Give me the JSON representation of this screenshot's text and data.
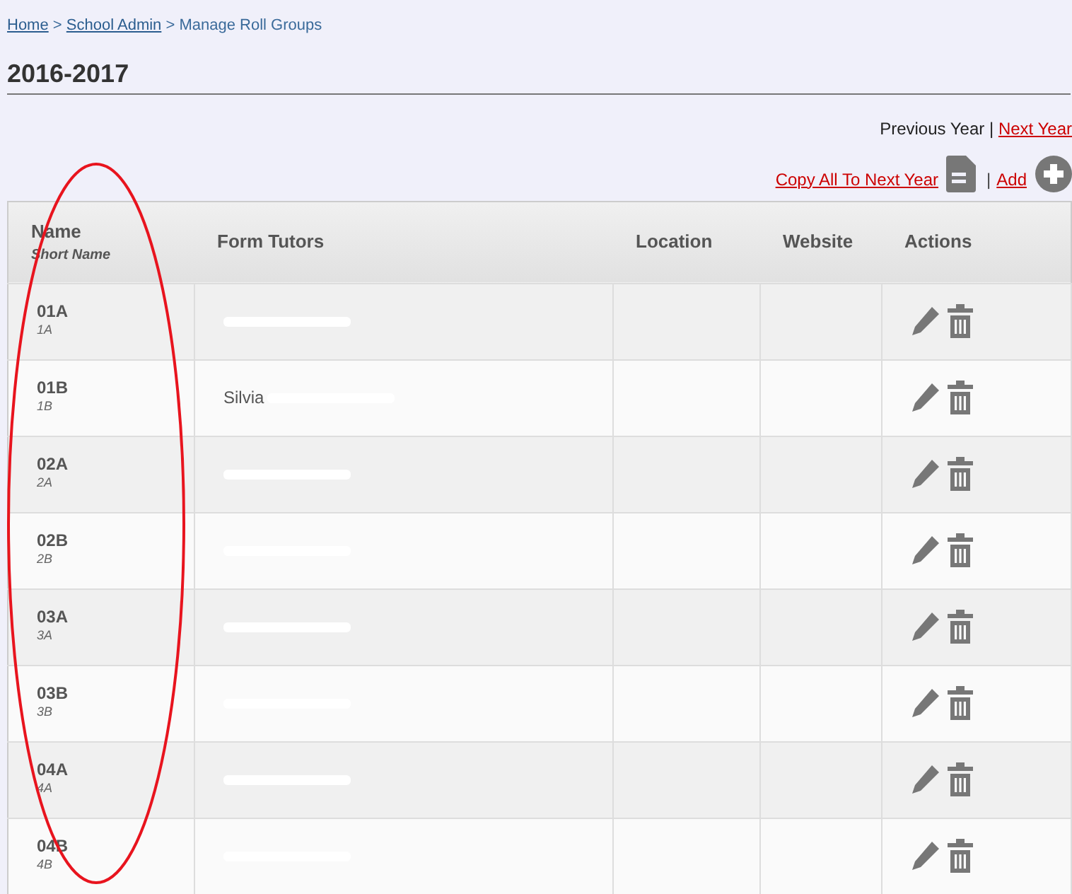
{
  "breadcrumb": [
    {
      "label": "Home",
      "link": true
    },
    {
      "label": ">",
      "link": false
    },
    {
      "label": "School Admin",
      "link": true
    },
    {
      "label": ">",
      "link": false
    },
    {
      "label": "Manage Roll Groups",
      "link": false
    }
  ],
  "title": "2016-2017",
  "year_nav": {
    "previous": "Previous Year",
    "separator": "|",
    "next": "Next Year"
  },
  "actions": {
    "copy": "Copy All To Next Year",
    "separator": "|",
    "add": "Add"
  },
  "table": {
    "columns": [
      {
        "label": "Name",
        "sublabel": "Short Name"
      },
      {
        "label": "Form Tutors"
      },
      {
        "label": "Location"
      },
      {
        "label": "Website"
      },
      {
        "label": "Actions"
      }
    ],
    "rows": [
      {
        "name": "01A",
        "short": "1A",
        "tutor": "",
        "redacted": true
      },
      {
        "name": "01B",
        "short": "1B",
        "tutor": "Silvia",
        "redacted": true
      },
      {
        "name": "02A",
        "short": "2A",
        "tutor": "",
        "redacted": true
      },
      {
        "name": "02B",
        "short": "2B",
        "tutor": "",
        "redacted": true
      },
      {
        "name": "03A",
        "short": "3A",
        "tutor": "",
        "redacted": true
      },
      {
        "name": "03B",
        "short": "3B",
        "tutor": "",
        "redacted": true
      },
      {
        "name": "04A",
        "short": "4A",
        "tutor": "",
        "redacted": true
      },
      {
        "name": "04B",
        "short": "4B",
        "tutor": "",
        "redacted": true
      }
    ]
  },
  "annotation": {
    "kind": "ellipse",
    "color": "#e8141e"
  }
}
